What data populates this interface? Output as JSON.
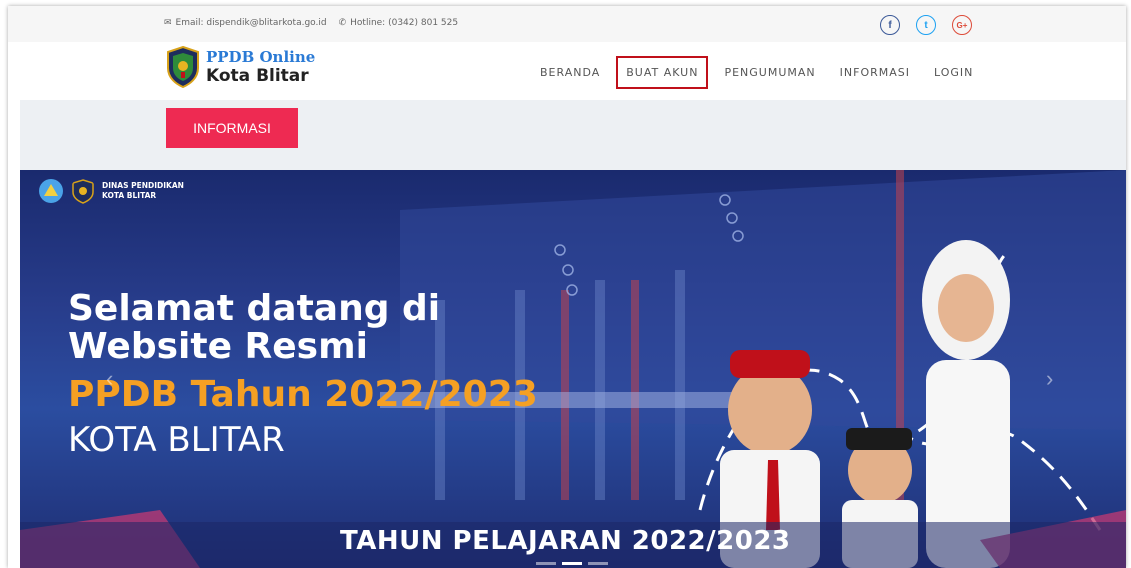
{
  "topbar": {
    "email": "Email: dispendik@blitarkota.go.id",
    "hotline": "Hotline: (0342) 801 525",
    "social": [
      {
        "icon": "facebook-icon",
        "glyph": "f",
        "color": "#3b5998"
      },
      {
        "icon": "twitter-icon",
        "glyph": "t",
        "color": "#1da1f2"
      },
      {
        "icon": "googleplus-icon",
        "glyph": "G+",
        "color": "#dd4b39"
      }
    ]
  },
  "brand": {
    "line1": "PPDB Online",
    "line2": "Kota Blitar"
  },
  "nav": {
    "items": [
      "BERANDA",
      "BUAT AKUN",
      "PENGUMUMAN",
      "INFORMASI",
      "LOGIN"
    ]
  },
  "info_button": "INFORMASI",
  "banner": {
    "org_line1": "DINAS PENDIDIKAN",
    "org_line2": "KOTA BLITAR",
    "welcome_line1": "Selamat datang di",
    "welcome_line2": "Website Resmi",
    "headline": "PPDB Tahun 2022/2023",
    "city": "KOTA BLITAR",
    "footer": "TAHUN PELAJARAN 2022/2023"
  },
  "colors": {
    "accent": "#ee2a52",
    "highlight_border": "#c0101a",
    "headline": "#f5a023",
    "brand_blue": "#2a7ad5"
  }
}
